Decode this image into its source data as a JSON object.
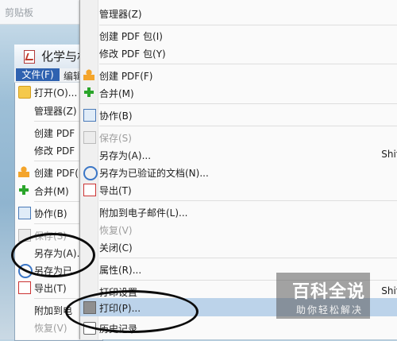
{
  "top_hint": "剪贴板",
  "background_window": {
    "title": "化学与材",
    "menubar": {
      "file": "文件(F)",
      "edit": "编辑"
    },
    "left_menu": [
      {
        "label": "打开(O)...",
        "icon": "folder-icon",
        "disabled": false
      },
      {
        "label": "管理器(Z)",
        "icon": "",
        "disabled": false
      },
      {
        "label": "创建 PDF",
        "icon": "",
        "disabled": false
      },
      {
        "label": "修改 PDF",
        "icon": "",
        "disabled": false
      },
      {
        "label": "创建 PDF(",
        "icon": "create-pdf-icon",
        "disabled": false
      },
      {
        "label": "合并(M)",
        "icon": "combine-icon",
        "disabled": false
      },
      {
        "label": "协作(B)",
        "icon": "collaborate-icon",
        "disabled": false
      },
      {
        "label": "保存(S)",
        "icon": "save-icon",
        "disabled": true
      },
      {
        "label": "另存为(A)...",
        "icon": "",
        "disabled": false
      },
      {
        "label": "另存为已",
        "icon": "certified-icon",
        "disabled": false
      },
      {
        "label": "导出(T)",
        "icon": "export-icon",
        "disabled": false
      },
      {
        "label": "附加到电",
        "icon": "",
        "disabled": false
      },
      {
        "label": "恢复(V)",
        "icon": "",
        "disabled": true
      }
    ]
  },
  "file_menu": {
    "items": [
      {
        "label": "管理器(Z)",
        "icon": "",
        "disabled": false,
        "shortcut": ""
      },
      {
        "label": "创建 PDF 包(I)",
        "icon": "",
        "disabled": false,
        "shortcut": ""
      },
      {
        "label": "修改 PDF 包(Y)",
        "icon": "",
        "disabled": false,
        "shortcut": ""
      },
      {
        "label": "创建 PDF(F)",
        "icon": "create-pdf-icon",
        "disabled": false,
        "shortcut": ""
      },
      {
        "label": "合并(M)",
        "icon": "combine-icon",
        "disabled": false,
        "shortcut": ""
      },
      {
        "label": "协作(B)",
        "icon": "collaborate-icon",
        "disabled": false,
        "shortcut": ""
      },
      {
        "label": "保存(S)",
        "icon": "save-icon",
        "disabled": true,
        "shortcut": ""
      },
      {
        "label": "另存为(A)...",
        "icon": "",
        "disabled": false,
        "shortcut": "Shif"
      },
      {
        "label": "另存为已验证的文档(N)...",
        "icon": "certified-document-icon",
        "disabled": false,
        "shortcut": ""
      },
      {
        "label": "导出(T)",
        "icon": "export-icon",
        "disabled": false,
        "shortcut": ""
      },
      {
        "label": "附加到电子邮件(L)...",
        "icon": "",
        "disabled": false,
        "shortcut": ""
      },
      {
        "label": "恢复(V)",
        "icon": "",
        "disabled": true,
        "shortcut": ""
      },
      {
        "label": "关闭(C)",
        "icon": "",
        "disabled": false,
        "shortcut": ""
      },
      {
        "label": "属性(R)...",
        "icon": "",
        "disabled": false,
        "shortcut": ""
      },
      {
        "label": "打印设置",
        "icon": "",
        "disabled": false,
        "shortcut": "Shif"
      },
      {
        "label": "打印(P)...",
        "icon": "printer-icon",
        "disabled": false,
        "shortcut": "",
        "highlighted": true
      },
      {
        "label": "历史记录",
        "icon": "history-icon",
        "disabled": false,
        "shortcut": ""
      }
    ]
  },
  "watermark": {
    "title": "百科全说",
    "subtitle": "助你轻松解决"
  }
}
